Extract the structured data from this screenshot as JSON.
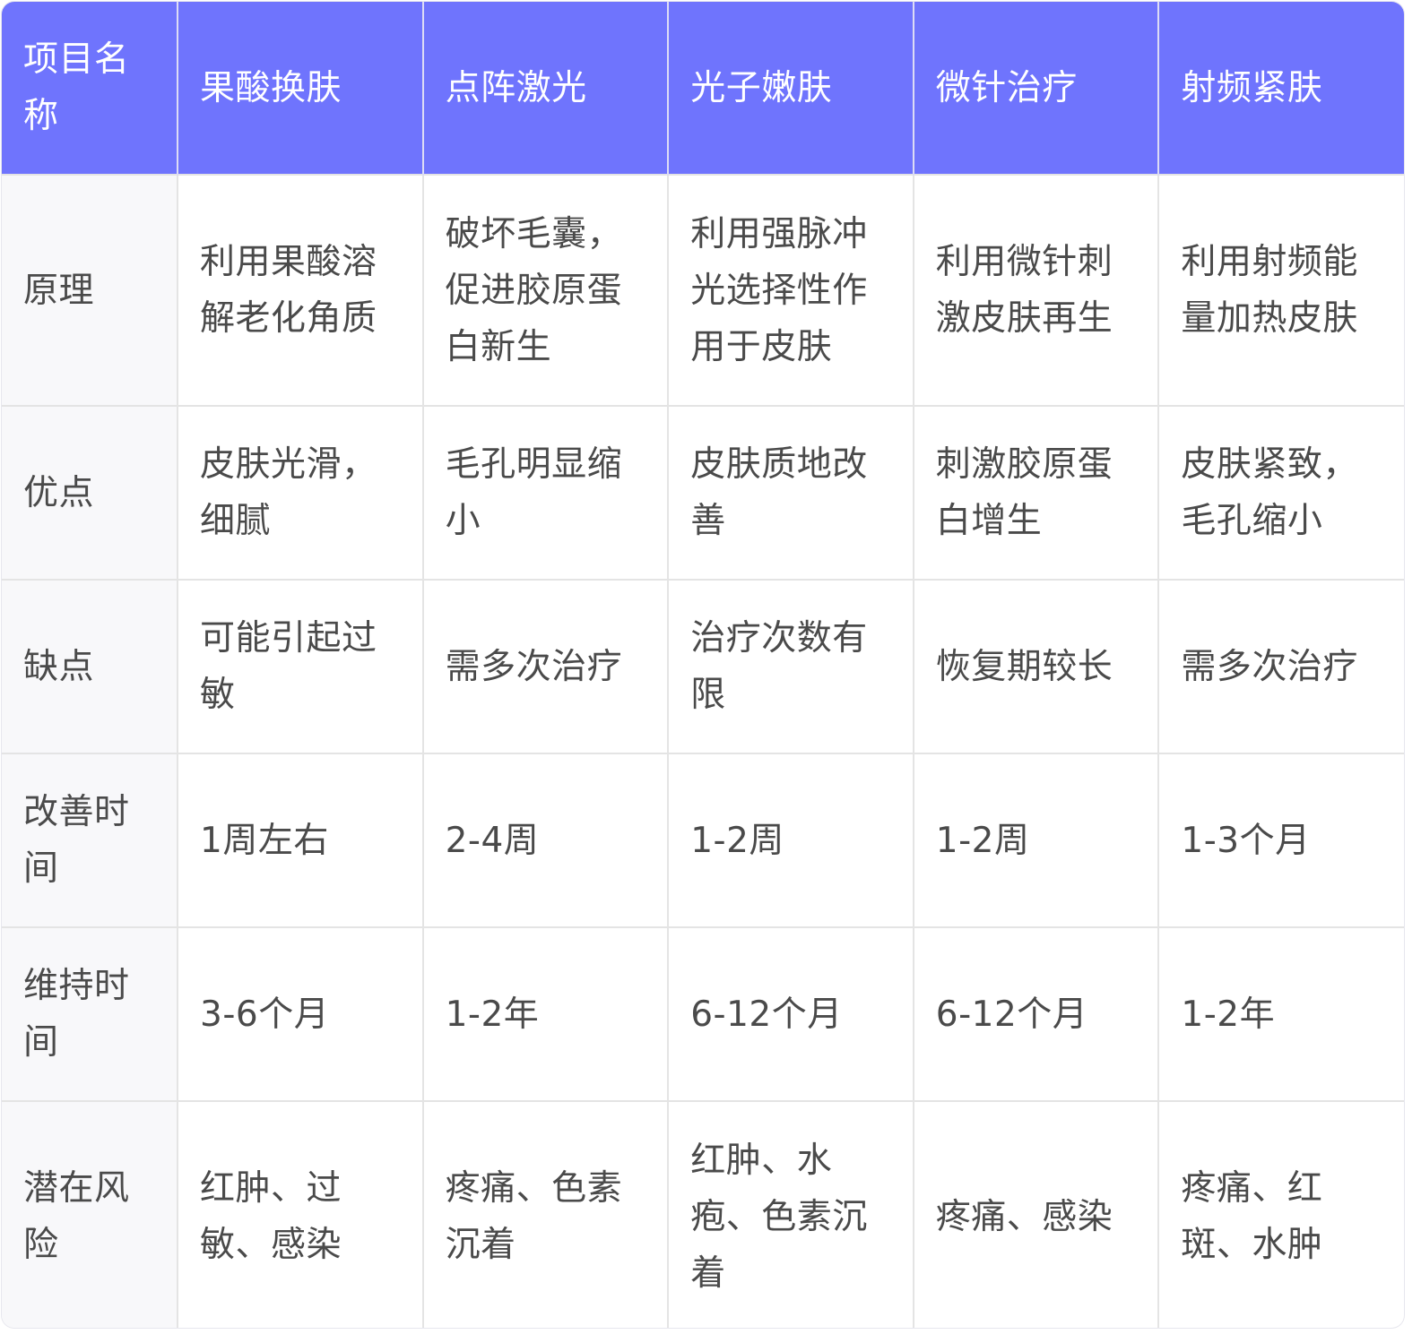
{
  "table": {
    "headers": [
      "项目名称",
      "果酸换肤",
      "点阵激光",
      "光子嫩肤",
      "微针治疗",
      "射频紧肤"
    ],
    "rows": [
      {
        "label": "原理",
        "cells": [
          "利用果酸溶解老化角质",
          "破坏毛囊，促进胶原蛋白新生",
          "利用强脉冲光选择性作用于皮肤",
          "利用微针刺激皮肤再生",
          "利用射频能量加热皮肤"
        ]
      },
      {
        "label": "优点",
        "cells": [
          "皮肤光滑，细腻",
          "毛孔明显缩小",
          "皮肤质地改善",
          "刺激胶原蛋白增生",
          "皮肤紧致，毛孔缩小"
        ]
      },
      {
        "label": "缺点",
        "cells": [
          "可能引起过敏",
          "需多次治疗",
          "治疗次数有限",
          "恢复期较长",
          "需多次治疗"
        ]
      },
      {
        "label": "改善时间",
        "cells": [
          "1周左右",
          "2-4周",
          "1-2周",
          "1-2周",
          "1-3个月"
        ]
      },
      {
        "label": "维持时间",
        "cells": [
          "3-6个月",
          "1-2年",
          "6-12个月",
          "6-12个月",
          "1-2年"
        ]
      },
      {
        "label": "潜在风险",
        "cells": [
          "红肿、过敏、感染",
          "疼痛、色素沉着",
          "红肿、水疱、色素沉着",
          "疼痛、感染",
          "疼痛、红斑、水肿"
        ]
      }
    ]
  },
  "colors": {
    "header_bg": "#6f74fd",
    "header_text": "#ffffff",
    "body_text": "#4a4a4a",
    "grid_line": "#e4e4e4",
    "label_bg": "#f8f8fa"
  }
}
